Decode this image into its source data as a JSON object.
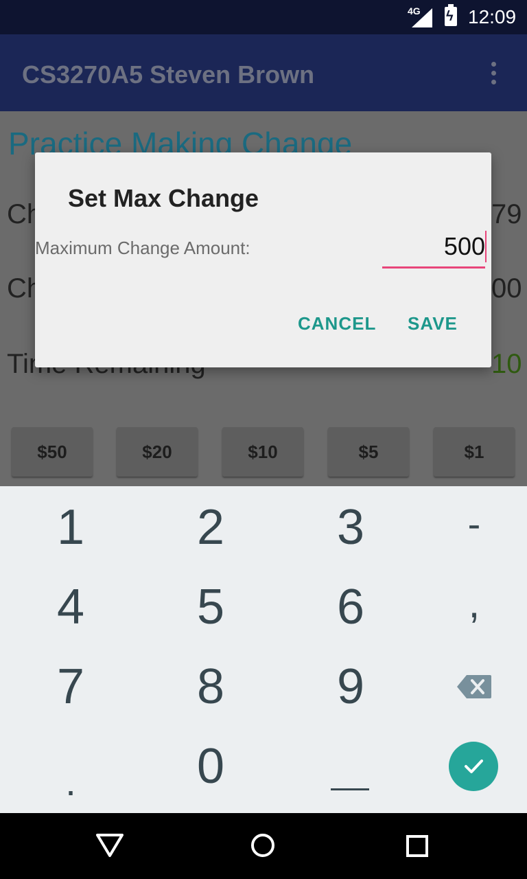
{
  "status_bar": {
    "network": "4G",
    "time": "12:09"
  },
  "app_bar": {
    "title": "CS3270A5 Steven Brown",
    "menu_icon": "overflow-menu-icon"
  },
  "main": {
    "heading": "Practice Making Change",
    "row1_partial_label": "Ch",
    "row1_partial_value": "79",
    "row2_partial_label": "Ch",
    "row2_partial_value": "00",
    "row3_partial_label": "Time Remaining",
    "row3_partial_value": "10",
    "row3_value_color": "#2f5a10",
    "money_buttons": [
      "$50",
      "$20",
      "$10",
      "$5",
      "$1"
    ]
  },
  "dialog": {
    "title": "Set Max Change",
    "label": "Maximum Change Amount:",
    "input_value": "500",
    "cancel_label": "CANCEL",
    "save_label": "SAVE",
    "accent": "#1d978b"
  },
  "keyboard": {
    "keys": [
      "1",
      "2",
      "3",
      "-",
      "4",
      "5",
      "6",
      ",",
      "7",
      "8",
      "9",
      ".",
      "0"
    ],
    "backspace_icon": "backspace-icon",
    "done_icon": "check-icon",
    "space_icon": "space-underscore-icon"
  },
  "nav_bar": {
    "back_icon": "back-triangle-icon",
    "home_icon": "home-circle-icon",
    "recents_icon": "recents-square-icon"
  }
}
